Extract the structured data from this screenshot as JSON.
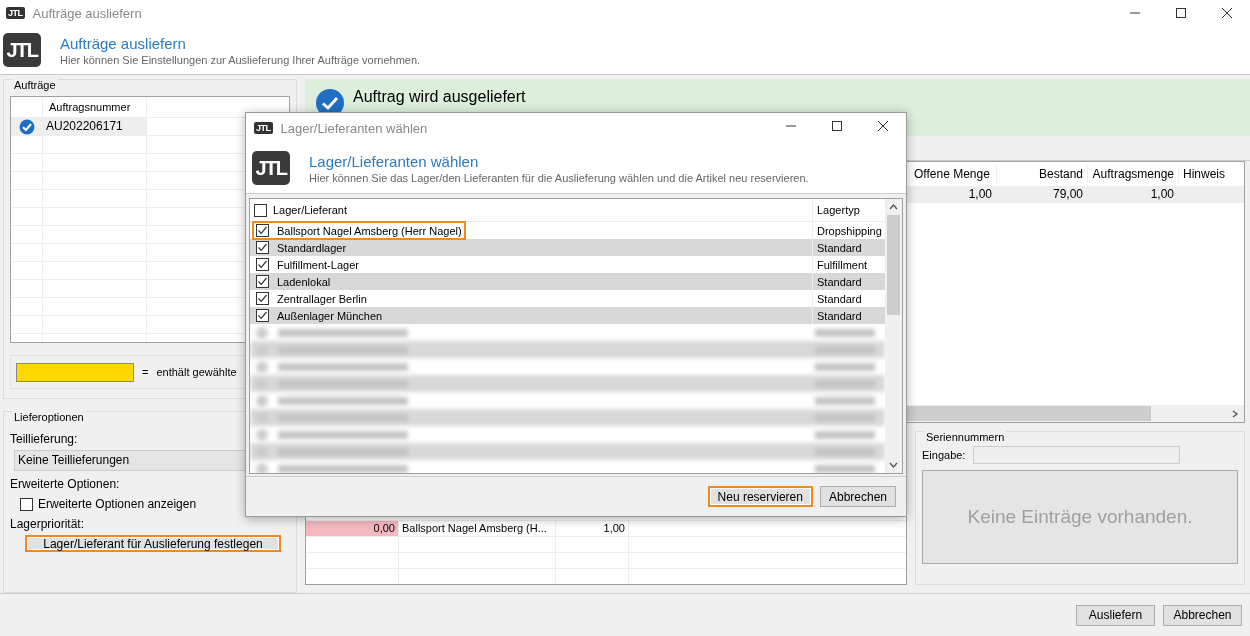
{
  "window": {
    "logo": "JTL",
    "title": "Aufträge ausliefern"
  },
  "header": {
    "logo": "JTL",
    "title": "Aufträge ausliefern",
    "subtitle": "Hier können Sie Einstellungen zur Auslieferung Ihrer Aufträge vornehmen."
  },
  "orders": {
    "group_title": "Aufträge",
    "columns": [
      "Auftragsnummer"
    ],
    "rows": [
      {
        "number": "AU202206171",
        "selected": true
      }
    ]
  },
  "legend": {
    "equals": "=",
    "text": "enthält gewählte"
  },
  "delivery_options": {
    "group_title": "Lieferoptionen",
    "partial_label": "Teillieferung:",
    "partial_value": "Keine Teillieferungen",
    "advanced_label": "Erweiterte Optionen:",
    "advanced_checkbox": {
      "label": "Erweiterte Optionen anzeigen",
      "checked": false
    },
    "priority_label": "Lagerpriorität:",
    "priority_button": {
      "label": "Lager/Lieferant für Auslieferung festlegen",
      "highlighted": true
    }
  },
  "status_banner": {
    "text": "Auftrag wird ausgeliefert"
  },
  "positions": {
    "columns": [
      "Offene Menge",
      "Bestand",
      "Auftragsmenge",
      "Hinweis"
    ],
    "rows": [
      {
        "cells": [
          "1,00",
          "79,00",
          "1,00"
        ]
      }
    ]
  },
  "stock": {
    "rows": [
      {
        "cells": [
          "0,00",
          "Ballsport Nagel Amsberg (H...",
          "1,00"
        ],
        "warning": true
      }
    ]
  },
  "serials": {
    "group_title": "Seriennummern",
    "input_label": "Eingabe:",
    "empty_text": "Keine Einträge vorhanden."
  },
  "buttons": [
    {
      "label": "Ausliefern"
    },
    {
      "label": "Abbrechen"
    }
  ],
  "dialog": {
    "logo": "JTL",
    "header_logo": "JTL",
    "title": "Lager/Lieferanten wählen",
    "heading": "Lager/Lieferanten wählen",
    "subtitle": "Hier können Sie das Lager/den Lieferanten für die Auslieferung wählen und die Artikel neu reservieren.",
    "select_all_checked": false,
    "columns": [
      "Lager/Lieferant",
      "Lagertyp"
    ],
    "rows": [
      {
        "name": "Ballsport Nagel Amsberg (Herr Nagel)",
        "type": "Dropshipping",
        "checked": true,
        "highlighted": true
      },
      {
        "name": "Standardlager",
        "type": "Standard",
        "checked": true,
        "highlighted": false
      },
      {
        "name": "Fulfillment-Lager",
        "type": "Fulfillment",
        "checked": true,
        "highlighted": false
      },
      {
        "name": "Ladenlokal",
        "type": "Standard",
        "checked": true,
        "highlighted": false
      },
      {
        "name": "Zentrallager Berlin",
        "type": "Standard",
        "checked": true,
        "highlighted": false
      },
      {
        "name": "Außenlager München",
        "type": "Standard",
        "checked": true,
        "highlighted": false
      },
      {
        "kind": "blurred"
      },
      {
        "kind": "blurred"
      },
      {
        "kind": "blurred"
      },
      {
        "kind": "blurred"
      },
      {
        "kind": "blurred"
      },
      {
        "kind": "blurred"
      },
      {
        "kind": "blurred"
      },
      {
        "kind": "blurred"
      },
      {
        "kind": "blurred"
      }
    ],
    "buttons": [
      {
        "label": "Neu reservieren",
        "highlighted": true
      },
      {
        "label": "Abbrechen",
        "highlighted": false
      }
    ]
  }
}
